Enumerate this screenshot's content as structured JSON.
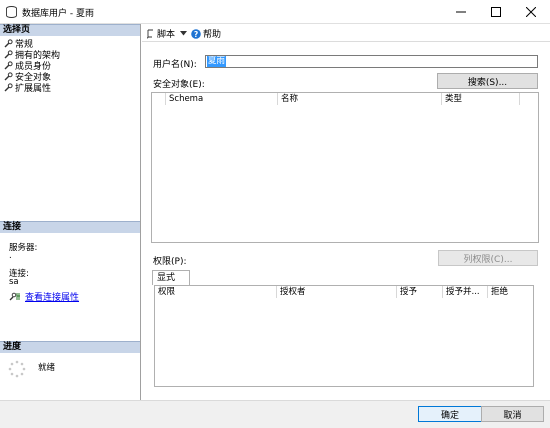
{
  "window": {
    "title": "数据库用户 - 夏雨",
    "minimize_icon": "minimize-icon",
    "maximize_icon": "maximize-icon",
    "close_icon": "close-icon"
  },
  "left_pane": {
    "select_page_header": "选择页",
    "pages": [
      {
        "label": "常规"
      },
      {
        "label": "拥有的架构"
      },
      {
        "label": "成员身份"
      },
      {
        "label": "安全对象"
      },
      {
        "label": "扩展属性"
      }
    ],
    "connection_header": "连接",
    "server_label": "服务器:",
    "server_value": ".",
    "connection_label": "连接:",
    "connection_value": "sa",
    "view_connection_link": "查看连接属性",
    "progress_header": "进度",
    "progress_status": "就绪"
  },
  "toolbar": {
    "script_label": "脚本",
    "help_label": "帮助"
  },
  "main": {
    "username_label": "用户名(N):",
    "username_value": "夏雨",
    "securables_label": "安全对象(E):",
    "search_button": "搜索(S)...",
    "securables_columns": [
      "Schema",
      "名称",
      "类型"
    ],
    "permissions_label": "权限(P):",
    "column_permissions_button": "列权限(C)...",
    "explicit_tab": "显式",
    "permissions_columns": [
      "权限",
      "授权者",
      "授予",
      "授予并...",
      "拒绝"
    ]
  },
  "footer": {
    "ok_button": "确定",
    "cancel_button": "取消"
  }
}
